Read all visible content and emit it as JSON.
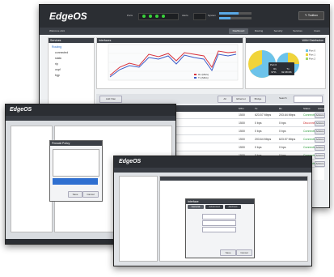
{
  "main": {
    "logo": "EdgeOS",
    "ports_label": "Ports",
    "alerts_label": "Alerts",
    "system_label": "System",
    "toolbox_label": "Toolbox",
    "user_label": "Welcome ubnt",
    "tabs": [
      "Dashboard",
      "Routing",
      "Security",
      "Services",
      "Users"
    ],
    "services_panel": {
      "title": "Services",
      "items": [
        "Routing",
        "connected",
        "static",
        "rip",
        "ospf",
        "bgp"
      ]
    },
    "interfaces_panel": {
      "title": "Interfaces"
    },
    "wan_panel": {
      "title": "WAN Distribution"
    },
    "legend": [
      "Port 0",
      "Port 1",
      "Port 2"
    ],
    "tooltip": {
      "title": "Port 0",
      "cols": [
        "Rx",
        "Tx"
      ],
      "vals": [
        "97%",
        "92.38 Mb"
      ]
    },
    "series": [
      "Rx (Mb/s)",
      "Tx (Mb/s)"
    ],
    "add_button": "Add Vlan",
    "filter_tabs": [
      "All",
      "Ethernet",
      "Bridge"
    ],
    "search_label": "Search",
    "table_headers": [
      "MTU",
      "Tx",
      "Rx",
      "Status",
      "Actions"
    ],
    "rows": [
      {
        "mtu": "1500",
        "tx": "623.57 Mbps",
        "rx": "203.64 Mbps",
        "status": "Connected",
        "action": "Actions"
      },
      {
        "mtu": "1500",
        "tx": "0 bps",
        "rx": "0 bps",
        "status": "Disconnected",
        "action": "Actions"
      },
      {
        "mtu": "1500",
        "tx": "0 bps",
        "rx": "0 bps",
        "status": "Connected",
        "action": "Actions"
      },
      {
        "mtu": "1500",
        "tx": "203.64 Mbps",
        "rx": "623.57 Mbps",
        "status": "Connected",
        "action": "Actions"
      },
      {
        "mtu": "1500",
        "tx": "0 bps",
        "rx": "0 bps",
        "status": "Connected",
        "action": "Actions"
      },
      {
        "mtu": "1500",
        "tx": "0 bps",
        "rx": "0 bps",
        "status": "Connected",
        "action": "Actions"
      },
      {
        "mtu": "1500",
        "tx": "0 bps",
        "rx": "0 bps",
        "status": "Connected",
        "action": "Actions"
      }
    ]
  },
  "mid": {
    "logo": "EdgeOS",
    "dialog_title": "Firewall Policy",
    "dialog_buttons": [
      "Save",
      "Cancel"
    ]
  },
  "front": {
    "logo": "EdgeOS",
    "dialog_title": "Interface",
    "dialog_tabs": [
      "General",
      "Advanced",
      "Address"
    ],
    "dialog_buttons": [
      "Save",
      "Cancel"
    ]
  },
  "colors": {
    "header": "#2b2e33",
    "pie_blue": "#6cc3ea",
    "pie_yellow": "#f0d43a",
    "line_red": "#d8323c",
    "line_blue": "#3b5cc8",
    "status_green": "#2a9a3a"
  }
}
